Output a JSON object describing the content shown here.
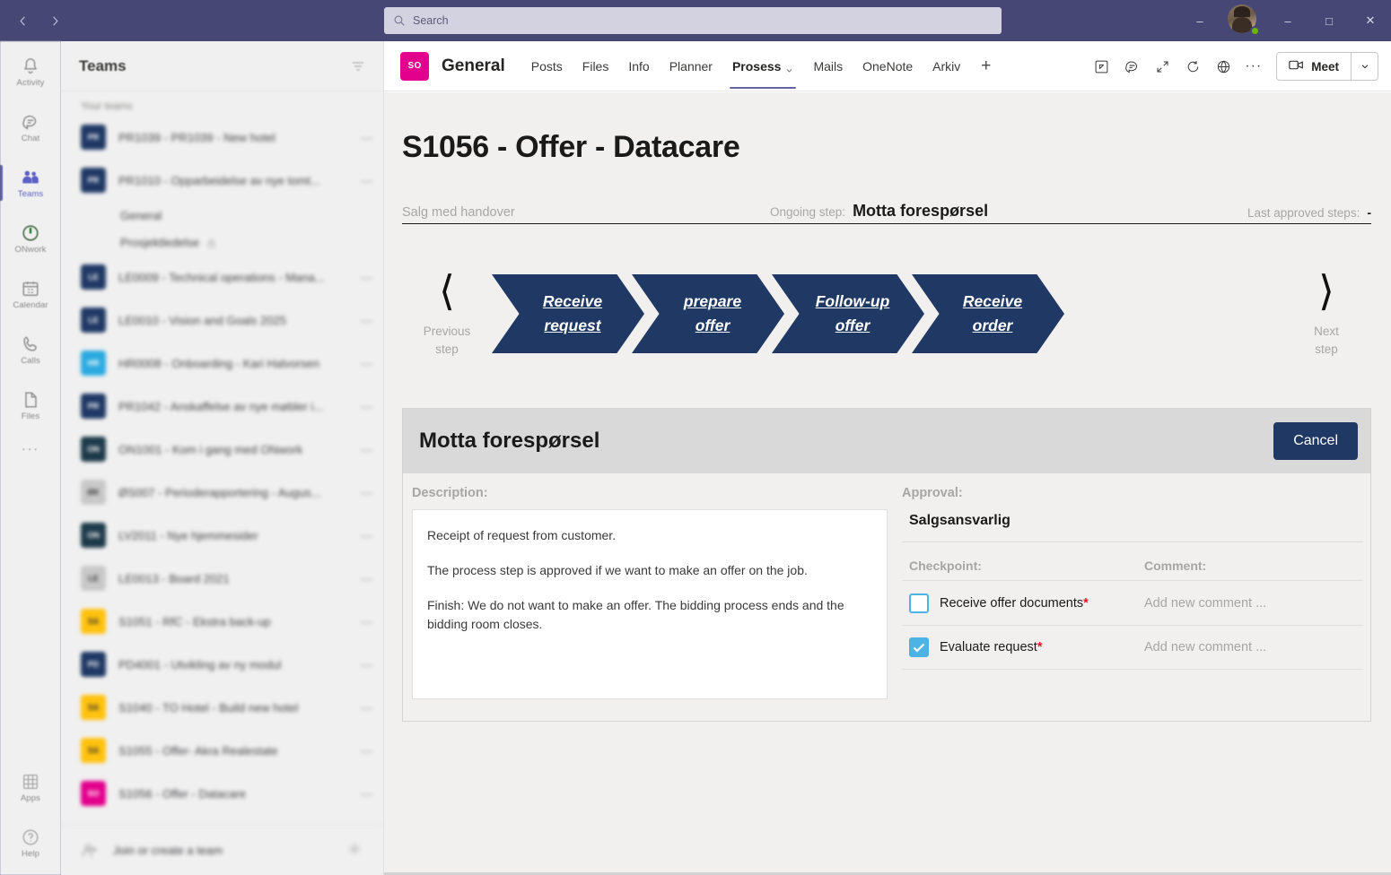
{
  "titlebar": {
    "back_icon": "chevron-left-icon",
    "forward_icon": "chevron-right-icon",
    "search_placeholder": "Search",
    "minimize_label": "–",
    "maximize_label": "□",
    "close_label": "✕",
    "presence_color": "#6bb700",
    "bar_color": "#464775"
  },
  "rail": {
    "items": [
      {
        "label": "Activity",
        "icon": "bell-icon",
        "active": false
      },
      {
        "label": "Chat",
        "icon": "chat-icon",
        "active": false
      },
      {
        "label": "Teams",
        "icon": "teams-icon",
        "active": true
      },
      {
        "label": "ONwork",
        "icon": "power-icon",
        "active": false
      },
      {
        "label": "Calendar",
        "icon": "calendar-icon",
        "active": false
      },
      {
        "label": "Calls",
        "icon": "phone-icon",
        "active": false
      },
      {
        "label": "Files",
        "icon": "file-icon",
        "active": false
      }
    ],
    "more_label": "···",
    "bottom": [
      {
        "label": "Apps",
        "icon": "apps-grid-icon"
      },
      {
        "label": "Help",
        "icon": "help-circle-icon"
      }
    ]
  },
  "teams_panel": {
    "title": "Teams",
    "filter_icon": "filter-icon",
    "section_label": "Your teams",
    "teams": [
      {
        "name": "PR1039 - PR1039 - New hotel",
        "initials": "PR",
        "color": "#1f3864"
      },
      {
        "name": "PR1010 - Opparbeidelse av nye tomt...",
        "initials": "PR",
        "color": "#1f3864",
        "channels": [
          {
            "name": "General",
            "private": false
          },
          {
            "name": "Prosjektledelse",
            "private": true
          }
        ]
      },
      {
        "name": "LE0009 - Technical operations - Mana...",
        "initials": "LE",
        "color": "#1f3864"
      },
      {
        "name": "LE0010 - Vision and Goals 2025",
        "initials": "LE",
        "color": "#1f3864"
      },
      {
        "name": "HR0008 - Onboarding - Kari Halvorsen",
        "initials": "HR",
        "color": "#2aaae0"
      },
      {
        "name": "PR1042 - Anskaffelse av nye møbler i...",
        "initials": "PR",
        "color": "#1f3864"
      },
      {
        "name": "ON1001 - Kom i gang med ONwork",
        "initials": "ON",
        "color": "#1d3a4a"
      },
      {
        "name": "ØS007 - Perioderapportering - Augus...",
        "initials": "ØK",
        "color": "#c8c8c8"
      },
      {
        "name": "LV2011 - Nye hjemmesider",
        "initials": "ON",
        "color": "#1d3a4a"
      },
      {
        "name": "LE0013 - Board 2021",
        "initials": "LE",
        "color": "#c8c8c8"
      },
      {
        "name": "S1051 - RfC - Ekstra back-up",
        "initials": "SA",
        "color": "#ffc20e"
      },
      {
        "name": "PD4001 - Utvikling av ny modul",
        "initials": "PD",
        "color": "#1f3864"
      },
      {
        "name": "S1040 - TO Hotel - Build new hotel",
        "initials": "SA",
        "color": "#ffc20e"
      },
      {
        "name": "S1055 - Offer- Akra Realestate",
        "initials": "SA",
        "color": "#ffc20e"
      },
      {
        "name": "S1056 - Offer - Datacare",
        "initials": "SO",
        "color": "#e3008c"
      }
    ],
    "footer": {
      "label": "Join or create a team",
      "icon": "join-team-icon",
      "settings_icon": "gear-icon"
    }
  },
  "channel_header": {
    "badge_initials": "SO",
    "badge_color": "#e3008c",
    "channel_name": "General",
    "tabs": [
      {
        "label": "Posts",
        "active": false,
        "dropdown": false
      },
      {
        "label": "Files",
        "active": false,
        "dropdown": false
      },
      {
        "label": "Info",
        "active": false,
        "dropdown": false
      },
      {
        "label": "Planner",
        "active": false,
        "dropdown": false
      },
      {
        "label": "Prosess",
        "active": true,
        "dropdown": true
      },
      {
        "label": "Mails",
        "active": false,
        "dropdown": false
      },
      {
        "label": "OneNote",
        "active": false,
        "dropdown": false
      },
      {
        "label": "Arkiv",
        "active": false,
        "dropdown": false
      }
    ],
    "add_tab_label": "+",
    "actions": [
      {
        "icon": "open-in-new-window-icon"
      },
      {
        "icon": "conversation-icon"
      },
      {
        "icon": "expand-icon"
      },
      {
        "icon": "refresh-icon"
      },
      {
        "icon": "globe-icon"
      }
    ],
    "more_label": "···",
    "meet_label": "Meet",
    "meet_icon": "video-camera-icon",
    "meet_dropdown_icon": "chevron-down-icon"
  },
  "process": {
    "title": "S1056 - Offer - Datacare",
    "process_name": "Salg med handover",
    "ongoing_step_label": "Ongoing step:",
    "ongoing_step_value": "Motta forespørsel",
    "last_approved_label": "Last approved steps:",
    "last_approved_value": "-",
    "previous_step_label": "Previous\nstep",
    "previous_step_line1": "Previous",
    "previous_step_line2": "step",
    "next_step_line1": "Next",
    "next_step_line2": "step",
    "prev_arrow_icon": "chevron-left-icon",
    "next_arrow_icon": "chevron-right-icon",
    "chevron_color": "#1f3864",
    "steps": [
      {
        "label": "Receive request"
      },
      {
        "label": "prepare offer"
      },
      {
        "label": "Follow-up offer"
      },
      {
        "label": "Receive order"
      }
    ]
  },
  "step_card": {
    "title": "Motta forespørsel",
    "cancel_label": "Cancel",
    "cancel_color": "#1f3864",
    "description_label": "Description:",
    "description_paragraphs": [
      "Receipt of request from customer.",
      "The process step is approved if we want to make an offer on the job.",
      "Finish: We do not want to make an offer. The bidding process ends and the bidding room closes."
    ],
    "approval_label": "Approval:",
    "approval_role": "Salgsansvarlig",
    "checkpoint_header": "Checkpoint:",
    "comment_header": "Comment:",
    "checkbox_color": "#4db2e4",
    "required_marker": "*",
    "checkpoints": [
      {
        "name": "Receive offer documents",
        "required": true,
        "checked": false,
        "comment_placeholder": "Add new comment ..."
      },
      {
        "name": "Evaluate request",
        "required": true,
        "checked": true,
        "comment_placeholder": "Add new comment ..."
      }
    ]
  }
}
